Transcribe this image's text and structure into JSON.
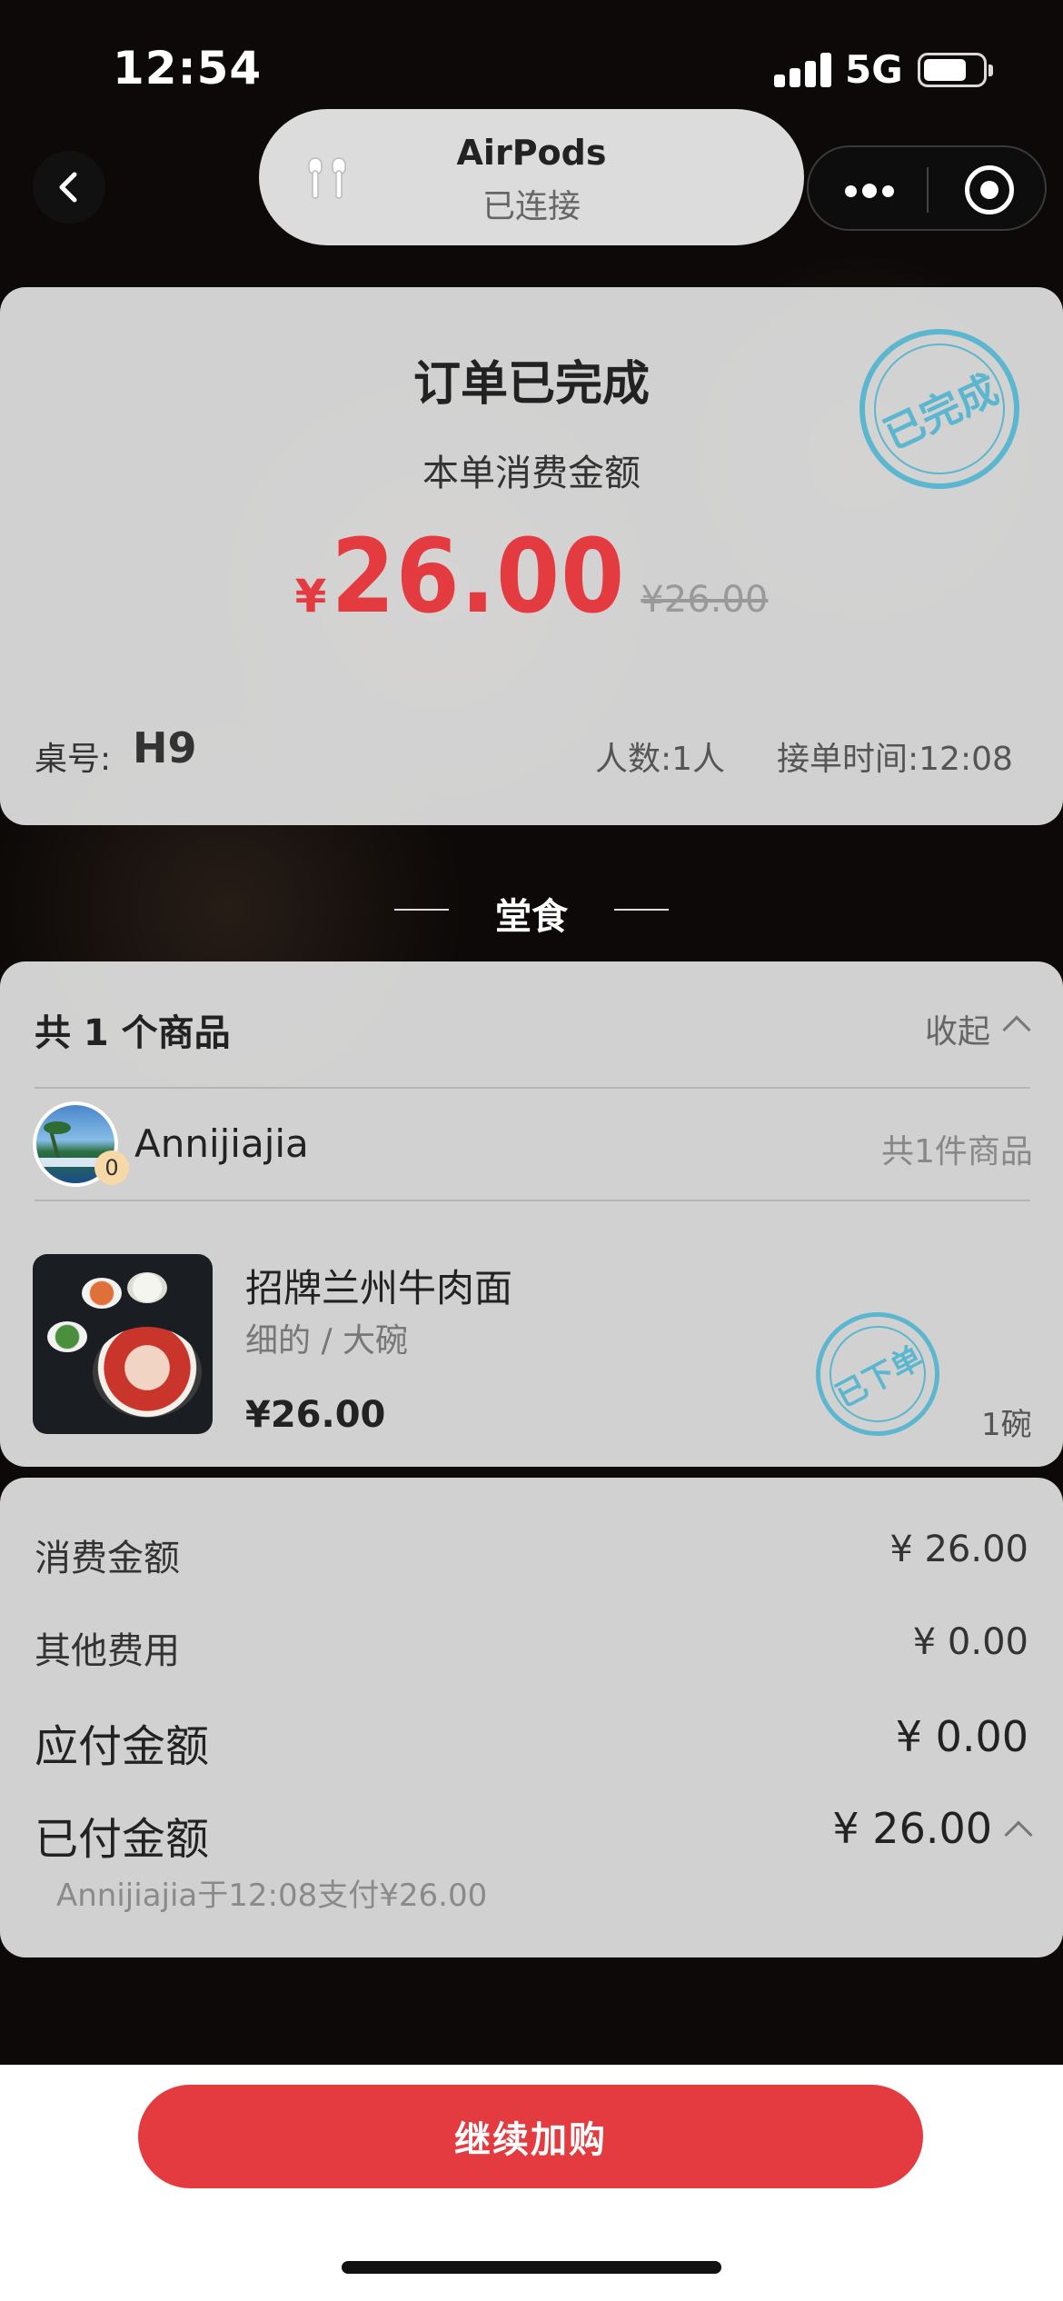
{
  "status_bar": {
    "time": "12:54",
    "network": "5G"
  },
  "nav": {
    "device_name": "AirPods",
    "device_status": "已连接"
  },
  "order": {
    "title": "订单已完成",
    "amount_label": "本单消费金额",
    "currency": "¥",
    "amount": "26.00",
    "original_amount": "¥26.00",
    "stamp": "已完成",
    "table_label": "桌号:",
    "table_no": "H9",
    "people": "人数:1人",
    "accept_time": "接单时间:12:08"
  },
  "dine": {
    "title": "堂食"
  },
  "items": {
    "count_text": "共 1 个商品",
    "collapse_label": "收起",
    "user": {
      "name": "Annijiajia",
      "badge": "0",
      "count_text": "共1件商品"
    },
    "products": [
      {
        "name": "招牌兰州牛肉面",
        "spec": "细的 / 大碗",
        "price": "¥26.00",
        "stamp": "已下单",
        "qty": "1碗"
      }
    ]
  },
  "summary": {
    "rows": [
      {
        "label": "消费金额",
        "value": "¥ 26.00"
      },
      {
        "label": "其他费用",
        "value": "¥ 0.00"
      },
      {
        "label": "应付金额",
        "value": "¥ 0.00"
      },
      {
        "label": "已付金额",
        "value": "¥ 26.00"
      }
    ],
    "paid_note": "Annijiajia于12:08支付¥26.00"
  },
  "bottom": {
    "continue_label": "继续加购"
  },
  "colors": {
    "accent": "#e33b40",
    "stamp": "#5bb6cf"
  }
}
